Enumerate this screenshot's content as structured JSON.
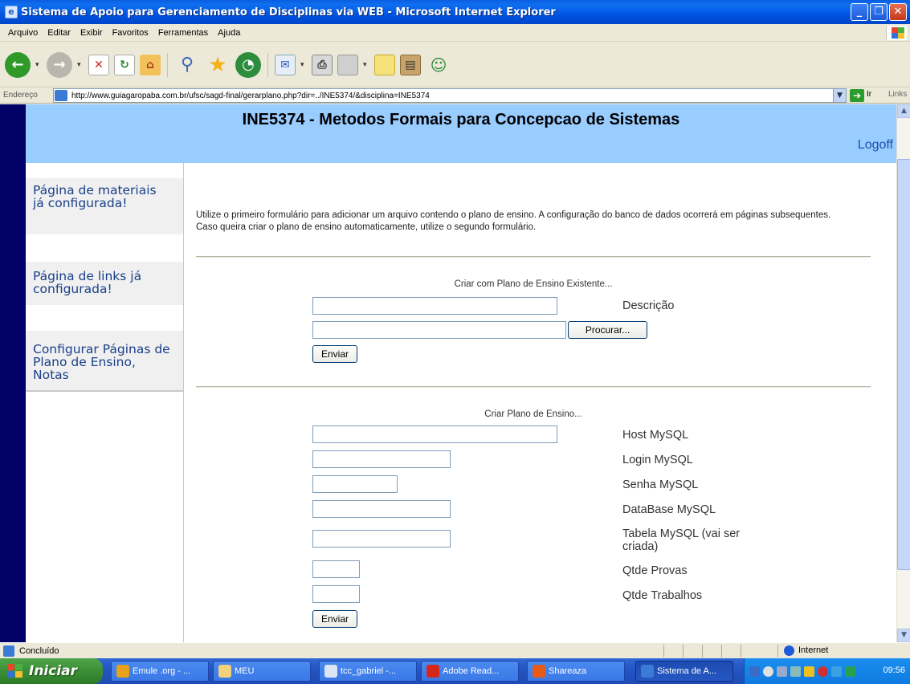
{
  "window": {
    "title": "Sistema de Apoio para Gerenciamento de Disciplinas via WEB - Microsoft Internet Explorer"
  },
  "menu": [
    "Arquivo",
    "Editar",
    "Exibir",
    "Favoritos",
    "Ferramentas",
    "Ajuda"
  ],
  "toolbar": {
    "icons": [
      "back-icon",
      "forward-icon",
      "stop-icon",
      "refresh-icon",
      "home-icon",
      "search-icon",
      "favorites-icon",
      "history-icon",
      "mail-icon",
      "print-icon",
      "edit-icon",
      "discuss-icon",
      "research-icon",
      "messenger-icon"
    ]
  },
  "address": {
    "label": "Endereço",
    "url": "http://www.guiagaropaba.com.br/ufsc/sagd-final/gerarplano.php?dir=../INE5374/&disciplina=INE5374",
    "go_label": "Ir",
    "links_label": "Links"
  },
  "page": {
    "course_title": "INE5374 - Metodos Formais para Concepcao de Sistemas",
    "logoff": "Logoff",
    "sidebar": [
      {
        "label": "Página de materiais já configurada!"
      },
      {
        "label": "Página de links já configurada!"
      },
      {
        "label": "Configurar Páginas de Plano de Ensino, Notas"
      }
    ],
    "intro_line1": "Utilize o primeiro formulário para adicionar um arquivo contendo o plano de ensino. A configuração do banco de dados ocorrerá em páginas subsequentes.",
    "intro_line2": "Caso queira criar o plano de ensino automaticamente, utilize o segundo formulário.",
    "form1": {
      "title": "Criar com Plano de Ensino Existente...",
      "descricao_label": "Descrição",
      "browse_label": "Procurar...",
      "submit_label": "Enviar"
    },
    "form2": {
      "title": "Criar Plano de Ensino...",
      "host_label": "Host MySQL",
      "login_label": "Login MySQL",
      "senha_label": "Senha MySQL",
      "database_label": "DataBase MySQL",
      "tabela_label": "Tabela MySQL (vai ser criada)",
      "provas_label": "Qtde Provas",
      "trabalhos_label": "Qtde Trabalhos",
      "submit_label": "Enviar"
    }
  },
  "status": {
    "text": "Concluído",
    "zone": "Internet"
  },
  "taskbar": {
    "start_label": "Iniciar",
    "tasks": [
      "Emule .org - ...",
      "MEU",
      "tcc_gabriel -...",
      "Adobe Read...",
      "Shareaza",
      "Sistema de A..."
    ],
    "clock": "09:56"
  }
}
